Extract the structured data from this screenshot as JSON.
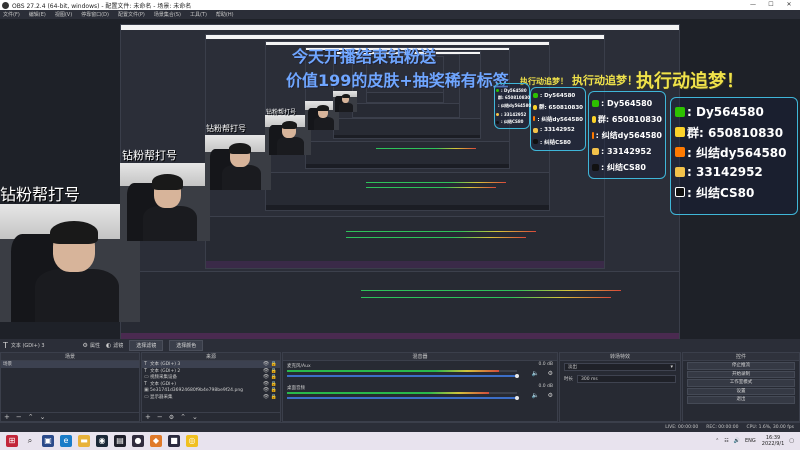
{
  "window": {
    "title": "OBS 27.2.4 (64-bit, windows) - 配置文件: 未命名 - 场景: 未命名",
    "minimize": "—",
    "maximize": "☐",
    "close": "✕"
  },
  "menu": [
    "文件(F)",
    "编辑(E)",
    "视图(V)",
    "停靠窗口(D)",
    "配置文件(P)",
    "场景集合(S)",
    "工具(T)",
    "帮助(H)"
  ],
  "preview": {
    "overlay_title_line1": "今天开播结束钻粉送",
    "overlay_title_line2": "价值199的皮肤+抽奖稀有标签",
    "overlay_slogan": "执行动追梦！",
    "caption": "钻粉帮打号",
    "contact_card": {
      "rows": [
        {
          "icon": "wechat-icon",
          "text": ": Dy564580"
        },
        {
          "icon": "qq-icon",
          "text": "群: 650810830"
        },
        {
          "icon": "douyu-icon",
          "text": ": 纠结dy564580"
        },
        {
          "icon": "bilibili-icon",
          "text": ": 33142952"
        },
        {
          "icon": "douyin-icon",
          "text": ": 纠结CS80"
        }
      ]
    }
  },
  "scene_label": "文本 (GDI+) 3",
  "scene_buttons": [
    "属性",
    "滤镜",
    "选择滤镜",
    "选择颜色"
  ],
  "panels": {
    "scenes": {
      "title": "场景",
      "items": [
        "场景"
      ]
    },
    "sources": {
      "title": "来源",
      "items": [
        {
          "type": "T",
          "label": "文本 (GDI+) 3"
        },
        {
          "type": "T",
          "label": "文本 (GDI+) 2"
        },
        {
          "type": "▭",
          "label": "视频采集设备"
        },
        {
          "type": "T",
          "label": "文本 (GDI+)"
        },
        {
          "type": "▣",
          "label": "5e31741d36924680f9b4e798be9f24.png"
        },
        {
          "type": "▭",
          "label": "显示器采集"
        }
      ]
    },
    "mixer": {
      "title": "混音器",
      "tracks": [
        {
          "name": "麦克风/Aux",
          "db": "0.0 dB",
          "level": 0.92
        },
        {
          "name": "桌面音频",
          "db": "0.0 dB",
          "level": 0.88
        }
      ]
    },
    "transitions": {
      "title": "转场特效",
      "type": "淡出",
      "duration_label": "时长",
      "duration": "300 ms"
    },
    "controls": {
      "title": "控件",
      "buttons": [
        "停止推流",
        "开始录制",
        "工作室模式",
        "设置",
        "退出"
      ]
    }
  },
  "status": {
    "live": "LIVE: 00:00:00",
    "rec": "REC: 00:00:00",
    "cpu": "CPU: 1.6%, 30.00 fps"
  },
  "taskbar": {
    "lang": "ENG",
    "time": "16:39",
    "date": "2022/9/1"
  },
  "colors": {
    "accent": "#3fb6d8",
    "slogan_yellow": "#f0e24a",
    "title_blue": "#6fa6ff"
  }
}
